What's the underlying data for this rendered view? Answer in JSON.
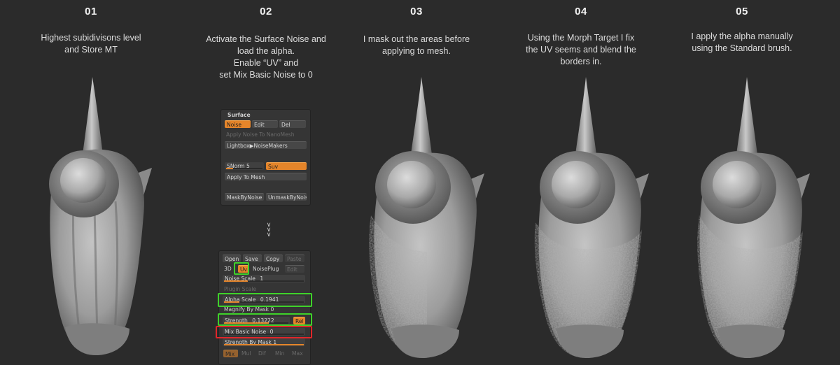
{
  "steps": [
    {
      "number": "01",
      "lines": [
        "Highest subidivisons level",
        "and Store MT"
      ]
    },
    {
      "number": "02",
      "lines": [
        "Activate the Surface Noise and",
        "load the alpha.",
        "Enable “UV” and",
        "set Mix Basic Noise to 0"
      ]
    },
    {
      "number": "03",
      "lines": [
        "I mask out the areas before",
        "applying to mesh."
      ]
    },
    {
      "number": "04",
      "lines": [
        "Using the Morph Target I fix",
        "the UV seems and blend the",
        "borders in."
      ]
    },
    {
      "number": "05",
      "lines": [
        "I apply the alpha manually",
        "using the Standard brush."
      ]
    }
  ],
  "surface_panel": {
    "title": "Surface",
    "noise": "Noise",
    "edit": "Edit",
    "del": "Del",
    "apply_noise_nanomesh": "Apply Noise To NanoMesh",
    "lightbox": "Lightbox▶NoiseMakers",
    "snorm": "SNorm 5",
    "suv": "Suv",
    "apply_to_mesh": "Apply To Mesh",
    "mask_by_noise": "MaskByNoise",
    "unmask_by_noise": "UnmaskByNoise"
  },
  "arrows": "v\nv\nv",
  "noise_panel": {
    "open": "Open",
    "save": "Save",
    "copy": "Copy",
    "paste": "Paste",
    "three_d": "3D",
    "uv": "Uv",
    "noiseplug": "NoisePlug",
    "edit": "Edit",
    "noise_scale": "Noise Scale",
    "noise_scale_value": "1",
    "plugin_scale": "Plugin Scale",
    "alpha_scale": "Alpha Scale",
    "alpha_scale_value": "0.1941",
    "magnify_by_mask": "Magnify By Mask 0",
    "strength": "Strength",
    "strength_value": "0.13222",
    "rel": "Rel",
    "mix_basic_noise": "Mix Basic Noise",
    "mix_basic_noise_value": "0",
    "strength_by_mask": "Strength By Mask 1",
    "modes": [
      "Mix",
      "Mul",
      "Dif",
      "Min",
      "Max"
    ],
    "noise_scale_level": 0.3,
    "alpha_scale_level": 0.19,
    "strength_level": 0.7,
    "mix_basic_noise_level": 0.0,
    "strength_by_mask_level": 1.0
  },
  "colors": {
    "background": "#2b2b2b",
    "accent_orange": "#e5852a",
    "highlight_green": "#3fd22a",
    "highlight_red": "#e0262a"
  },
  "models": [
    {
      "name": "sculpt-smooth",
      "texture": "smooth"
    },
    {
      "name": "sculpt-partial-noise",
      "texture": "noise"
    },
    {
      "name": "sculpt-blended-noise",
      "texture": "noise"
    },
    {
      "name": "sculpt-manual-alpha",
      "texture": "noise"
    }
  ]
}
